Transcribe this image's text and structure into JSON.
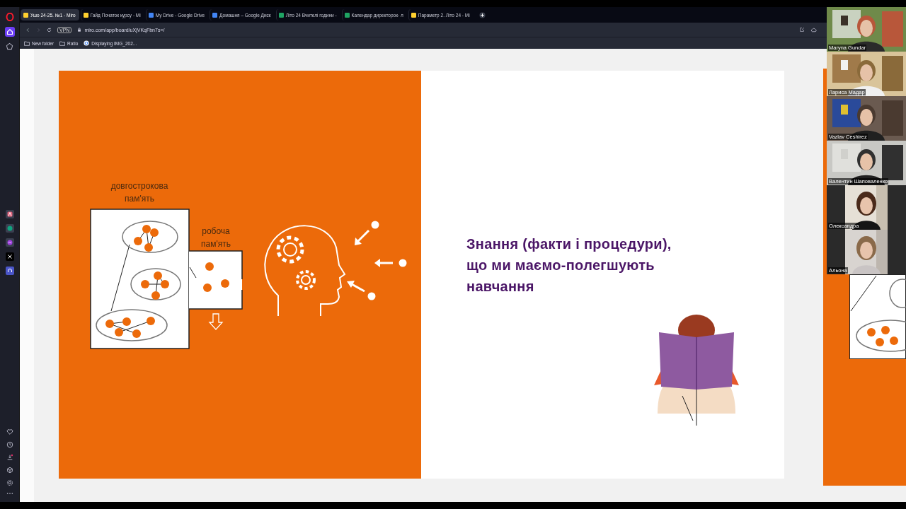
{
  "browser": {
    "tabs": [
      {
        "title": "Ушо 24-25. №1 - Miro",
        "selected": true,
        "kind": "miro"
      },
      {
        "title": "Гайд Початок курсу - Mi",
        "selected": false,
        "kind": "miro"
      },
      {
        "title": "My Drive - Google Drive",
        "selected": false,
        "kind": "drive"
      },
      {
        "title": "Домашня – Google Диск",
        "selected": false,
        "kind": "drive"
      },
      {
        "title": "Літо 24 Вчителі години -",
        "selected": false,
        "kind": "sheets"
      },
      {
        "title": "Календар директорок- л",
        "selected": false,
        "kind": "sheets"
      },
      {
        "title": "Параметр 2. Літо 24 - Mi",
        "selected": false,
        "kind": "miro"
      }
    ],
    "vpn": "VPN",
    "url": "miro.com/app/board/uXjVKqFbn7s=/",
    "bookmarks": [
      {
        "label": "New folder",
        "kind": "folder"
      },
      {
        "label": "Ratio",
        "kind": "folder"
      },
      {
        "label": "Displaying IMG_202...",
        "kind": "google"
      }
    ]
  },
  "slide": {
    "long_term_label": [
      "довгострокова",
      "пам'ять"
    ],
    "working_label": [
      "робоча",
      "пам'ять"
    ],
    "heading": "Знання (факти і процедури), що ми маємо-полегшують навчання"
  },
  "participants": [
    {
      "name": "Maryna Gundar",
      "kind": "wide"
    },
    {
      "name": "Лариса Мадар",
      "kind": "wide"
    },
    {
      "name": "Vazlav Ceshirez",
      "kind": "wide"
    },
    {
      "name": "Валентин Шаповаленко",
      "kind": "wide"
    },
    {
      "name": "Олександра",
      "kind": "portrait"
    },
    {
      "name": "Альона",
      "kind": "portrait"
    }
  ]
}
